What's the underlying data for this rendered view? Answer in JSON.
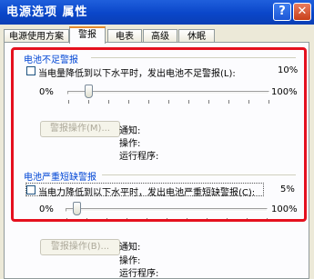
{
  "window": {
    "title": "电源选项 属性",
    "help_glyph": "?",
    "close_glyph": "✕"
  },
  "tabs": [
    {
      "label": "电源使用方案"
    },
    {
      "label": "警报"
    },
    {
      "label": "电表"
    },
    {
      "label": "高级"
    },
    {
      "label": "休眠"
    }
  ],
  "active_tab": "警报",
  "low_battery": {
    "group_title": "电池不足警报",
    "checkbox_label": "当电量降低到以下水平时，发出电池不足警报(L):",
    "checked": false,
    "level_percent": "10%",
    "slider_min": "0%",
    "slider_max": "100%",
    "slider_level": 0.1,
    "alarm_button": "警报操作(M)...",
    "notify_label": "通知:",
    "action_label": "操作:",
    "run_program_label": "运行程序:"
  },
  "critical_battery": {
    "group_title": "电池严重短缺警报",
    "checkbox_label": "当电力降低到以下水平时，发出电池严重短缺警报(C):",
    "checked": false,
    "level_percent": "5%",
    "slider_min": "0%",
    "slider_max": "100%",
    "slider_level": 0.05,
    "alarm_button": "警报操作(B)...",
    "notify_label": "通知:",
    "action_label": "操作:",
    "run_program_label": "运行程序:"
  },
  "colors": {
    "highlight_border": "#e5101e",
    "group_title": "#0046d5",
    "titlebar": "#0a46c9"
  }
}
